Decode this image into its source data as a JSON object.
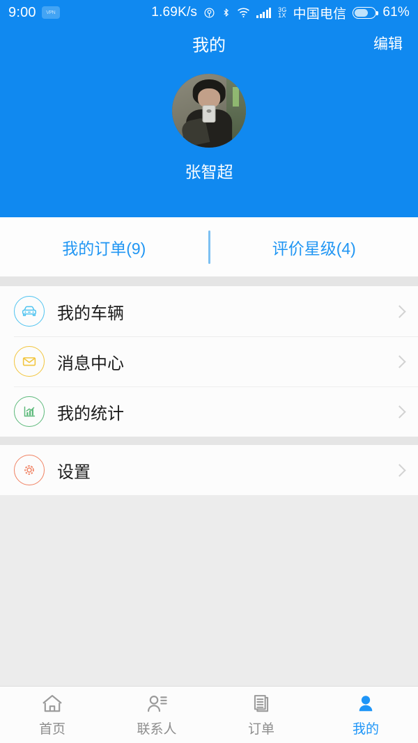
{
  "status_bar": {
    "time": "9:00",
    "badge_text": "VPN",
    "net_speed": "1.69K/s",
    "icons": [
      "location-icon",
      "bluetooth-icon",
      "wifi-icon",
      "signal-icon"
    ],
    "network_type_line1": "3G",
    "network_type_line2": "1X",
    "carrier": "中国电信",
    "battery_percent": "61%"
  },
  "header": {
    "title": "我的",
    "edit_label": "编辑",
    "user_name": "张智超",
    "avatar_name": "user-avatar-photo",
    "bg_color": "#1089f0"
  },
  "tabs": [
    {
      "label": "我的订单(9)",
      "name": "tab-my-orders",
      "count": 9
    },
    {
      "label": "评价星级(4)",
      "name": "tab-rating-stars",
      "count": 4
    }
  ],
  "menu_group_1": [
    {
      "label": "我的车辆",
      "icon": "car-icon",
      "color": "#4ec3f0",
      "name": "menu-item-my-vehicles"
    },
    {
      "label": "消息中心",
      "icon": "envelope-icon",
      "color": "#f2c53d",
      "name": "menu-item-message-center"
    },
    {
      "label": "我的统计",
      "icon": "bar-chart-icon",
      "color": "#5cb97a",
      "name": "menu-item-my-statistics"
    }
  ],
  "menu_group_2": [
    {
      "label": "设置",
      "icon": "gear-icon",
      "color": "#f08263",
      "name": "menu-item-settings"
    }
  ],
  "bottom_nav": [
    {
      "label": "首页",
      "icon": "home-icon",
      "name": "nav-home",
      "active": false
    },
    {
      "label": "联系人",
      "icon": "contacts-icon",
      "name": "nav-contacts",
      "active": false
    },
    {
      "label": "订单",
      "icon": "orders-icon",
      "name": "nav-orders",
      "active": false
    },
    {
      "label": "我的",
      "icon": "person-icon",
      "name": "nav-mine",
      "active": true
    }
  ],
  "colors": {
    "brand_blue": "#1089f0",
    "tab_blue": "#2196f3",
    "page_bg": "#ececec",
    "card_bg": "#fcfcfc",
    "inactive_gray": "#8d8d8d"
  }
}
